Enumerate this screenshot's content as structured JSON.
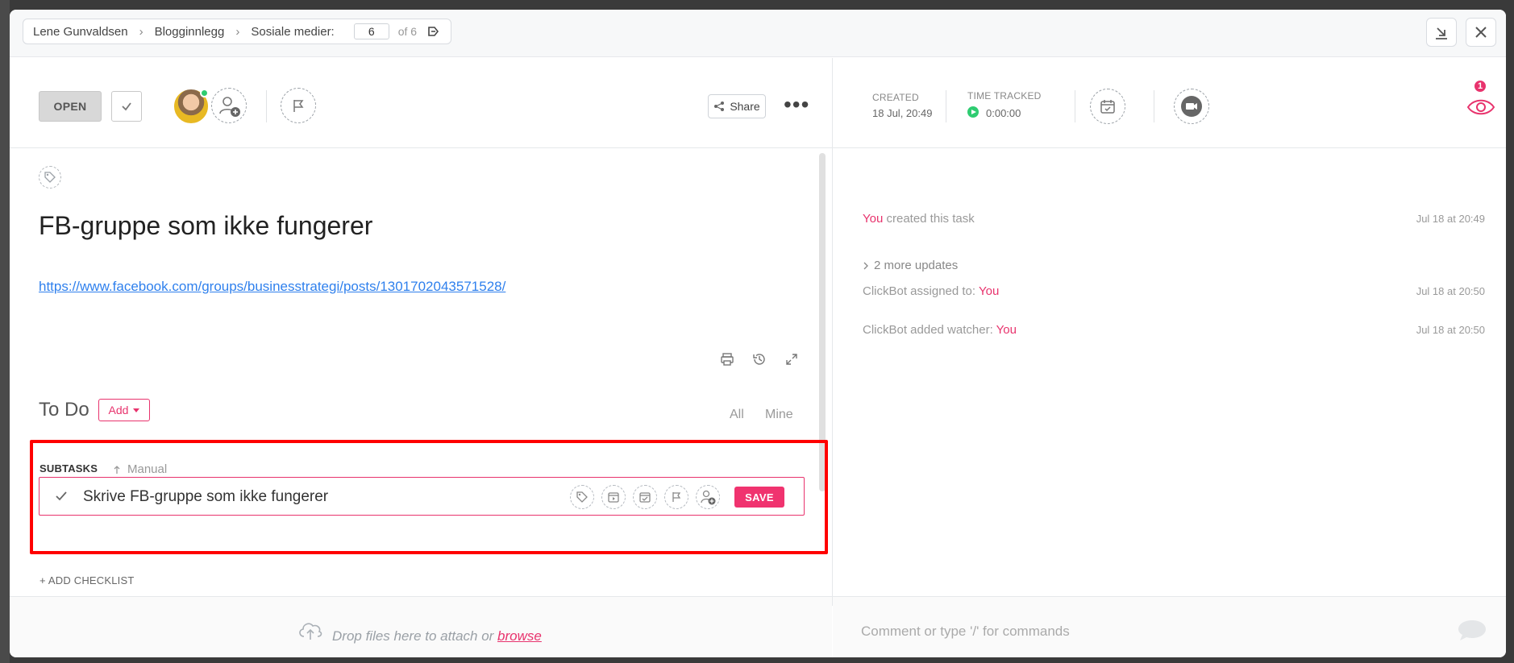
{
  "breadcrumb": {
    "items": [
      "Lene Gunvaldsen",
      "Blogginnlegg",
      "Sosiale medier:"
    ],
    "page_current": "6",
    "page_total": "of 6"
  },
  "header": {
    "status": "OPEN",
    "share_label": "Share",
    "more_label": "•••",
    "created_label": "CREATED",
    "created_value": "18 Jul, 20:49",
    "time_tracked_label": "TIME TRACKED",
    "time_tracked_value": "0:00:00",
    "watchers_count": "1"
  },
  "task": {
    "title": "FB-gruppe som ikke fungerer",
    "link": "https://www.facebook.com/groups/businesstrategi/posts/1301702043571528/"
  },
  "todo": {
    "title": "To Do",
    "add_label": "Add",
    "filter_all": "All",
    "filter_mine": "Mine",
    "subtasks_label": "SUBTASKS",
    "sort_label": "Manual",
    "subtask_text": "Skrive FB-gruppe som ikke fungerer",
    "save_label": "SAVE",
    "add_checklist": "+ ADD CHECKLIST"
  },
  "activity": {
    "you": "You",
    "created_text": " created this task",
    "created_time": "Jul 18 at 20:49",
    "more_updates": "2 more updates",
    "assigned_text": "ClickBot assigned to: ",
    "assigned_time": "Jul 18 at 20:50",
    "watcher_text": "ClickBot added watcher: ",
    "watcher_time": "Jul 18 at 20:50"
  },
  "footer": {
    "drop_text": "Drop files here to attach or ",
    "browse_label": "browse",
    "comment_placeholder": "Comment or type '/' for commands"
  },
  "colors": {
    "accent": "#e8336d",
    "link": "#2f80ed",
    "highlight": "#ff0000",
    "tracker_green": "#2ecc71"
  }
}
